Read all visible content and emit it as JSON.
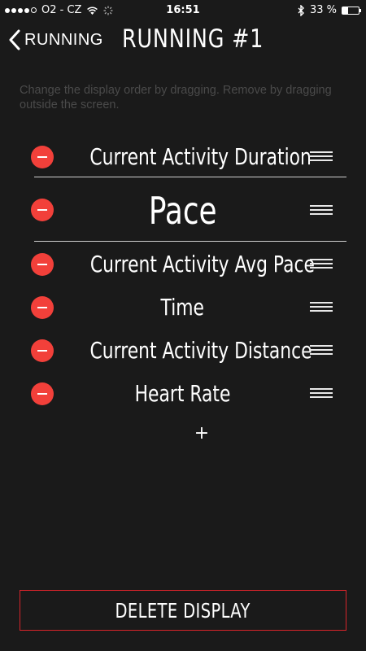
{
  "status_bar": {
    "carrier": "O2 - CZ",
    "time": "16:51",
    "battery_percent": "33 %",
    "battery_level": 0.33,
    "signal_bars_filled": 4,
    "signal_bars_total": 5,
    "icons": [
      "wifi-icon",
      "activity-spinner-icon",
      "bluetooth-icon",
      "battery-icon"
    ]
  },
  "nav": {
    "back_label": "RUNNING",
    "title": "RUNNING #1"
  },
  "instructions": "Change the display order by dragging. Remove by dragging outside the screen.",
  "fields": [
    {
      "label": "Current Activity Duration"
    },
    {
      "label": "Pace"
    },
    {
      "label": "Current Activity Avg Pace"
    },
    {
      "label": "Time"
    },
    {
      "label": "Current Activity Distance"
    },
    {
      "label": "Heart Rate"
    }
  ],
  "add_label": "+",
  "delete_display_label": "DELETE DISPLAY",
  "colors": {
    "background": "#1a1a1a",
    "remove_red": "#f2403a",
    "delete_border": "#d8242a",
    "instruction_gray": "#4a4a4a"
  }
}
